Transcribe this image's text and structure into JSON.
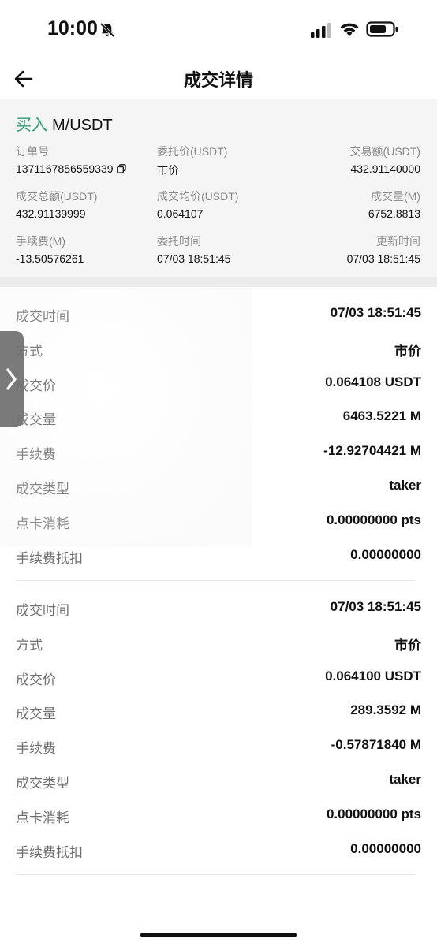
{
  "status_bar": {
    "time": "10:00",
    "icons": [
      "bell-slash-icon",
      "signal-icon",
      "wifi-icon",
      "battery-icon"
    ]
  },
  "nav": {
    "title": "成交详情",
    "back_icon": "back-arrow-icon"
  },
  "order": {
    "side": "买入",
    "pair": "M/USDT",
    "side_color": "#2e9b6e",
    "fields": {
      "order_no": {
        "label": "订单号",
        "value": "1371167856559339"
      },
      "order_price": {
        "label": "委托价(USDT)",
        "value": "市价"
      },
      "trade_amount": {
        "label": "交易额(USDT)",
        "value": "432.91140000"
      },
      "filled_total": {
        "label": "成交总额(USDT)",
        "value": "432.91139999"
      },
      "avg_price": {
        "label": "成交均价(USDT)",
        "value": "0.064107"
      },
      "filled_qty": {
        "label": "成交量(M)",
        "value": "6752.8813"
      },
      "fee": {
        "label": "手续费(M)",
        "value": "-13.50576261"
      },
      "order_time": {
        "label": "委托时间",
        "value": "07/03 18:51:45"
      },
      "update_time": {
        "label": "更新时间",
        "value": "07/03 18:51:45"
      }
    }
  },
  "trades": [
    {
      "rows": [
        {
          "label": "成交时间",
          "value": "07/03 18:51:45"
        },
        {
          "label": "方式",
          "value": "市价"
        },
        {
          "label": "成交价",
          "value": "0.064108 USDT"
        },
        {
          "label": "成交量",
          "value": "6463.5221 M"
        },
        {
          "label": "手续费",
          "value": "-12.92704421 M"
        },
        {
          "label": "成交类型",
          "value": "taker"
        },
        {
          "label": "点卡消耗",
          "value": "0.00000000 pts"
        },
        {
          "label": "手续费抵扣",
          "value": "0.00000000"
        }
      ]
    },
    {
      "rows": [
        {
          "label": "成交时间",
          "value": "07/03 18:51:45"
        },
        {
          "label": "方式",
          "value": "市价"
        },
        {
          "label": "成交价",
          "value": "0.064100 USDT"
        },
        {
          "label": "成交量",
          "value": "289.3592 M"
        },
        {
          "label": "手续费",
          "value": "-0.57871840 M"
        },
        {
          "label": "成交类型",
          "value": "taker"
        },
        {
          "label": "点卡消耗",
          "value": "0.00000000 pts"
        },
        {
          "label": "手续费抵扣",
          "value": "0.00000000"
        }
      ]
    }
  ]
}
